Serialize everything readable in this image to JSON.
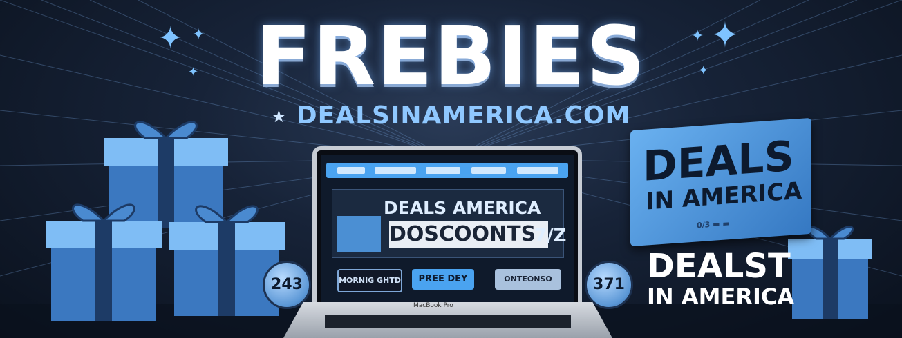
{
  "banner": {
    "title": "FREBIES",
    "subtitle": "DEALSINAMERICA.COM",
    "subtitle_star": "★"
  },
  "laptop": {
    "hero_heading": "DEALS AMERICA",
    "hero_subheading": "DOSCOONTS",
    "hero_number": "7/Z",
    "buttons": [
      "MORNIG GHTD",
      "PREE DEY",
      "ONTEONSO"
    ],
    "brand": "MacBook Pro"
  },
  "sign": {
    "line1": "DEALS",
    "line2": "IN AMERICA",
    "footer": "0/3 ▬ ▬"
  },
  "lower_text": {
    "line1": "DEALST",
    "line2": "IN AMERICA"
  },
  "badges": [
    "243",
    "371"
  ],
  "colors": {
    "accent": "#4aa3f0",
    "gift": "#5fa8f0",
    "background": "#172338",
    "text": "#ffffff"
  },
  "icons": [
    "sparkle-icon",
    "gift-box-icon",
    "laptop-icon",
    "star-icon"
  ]
}
